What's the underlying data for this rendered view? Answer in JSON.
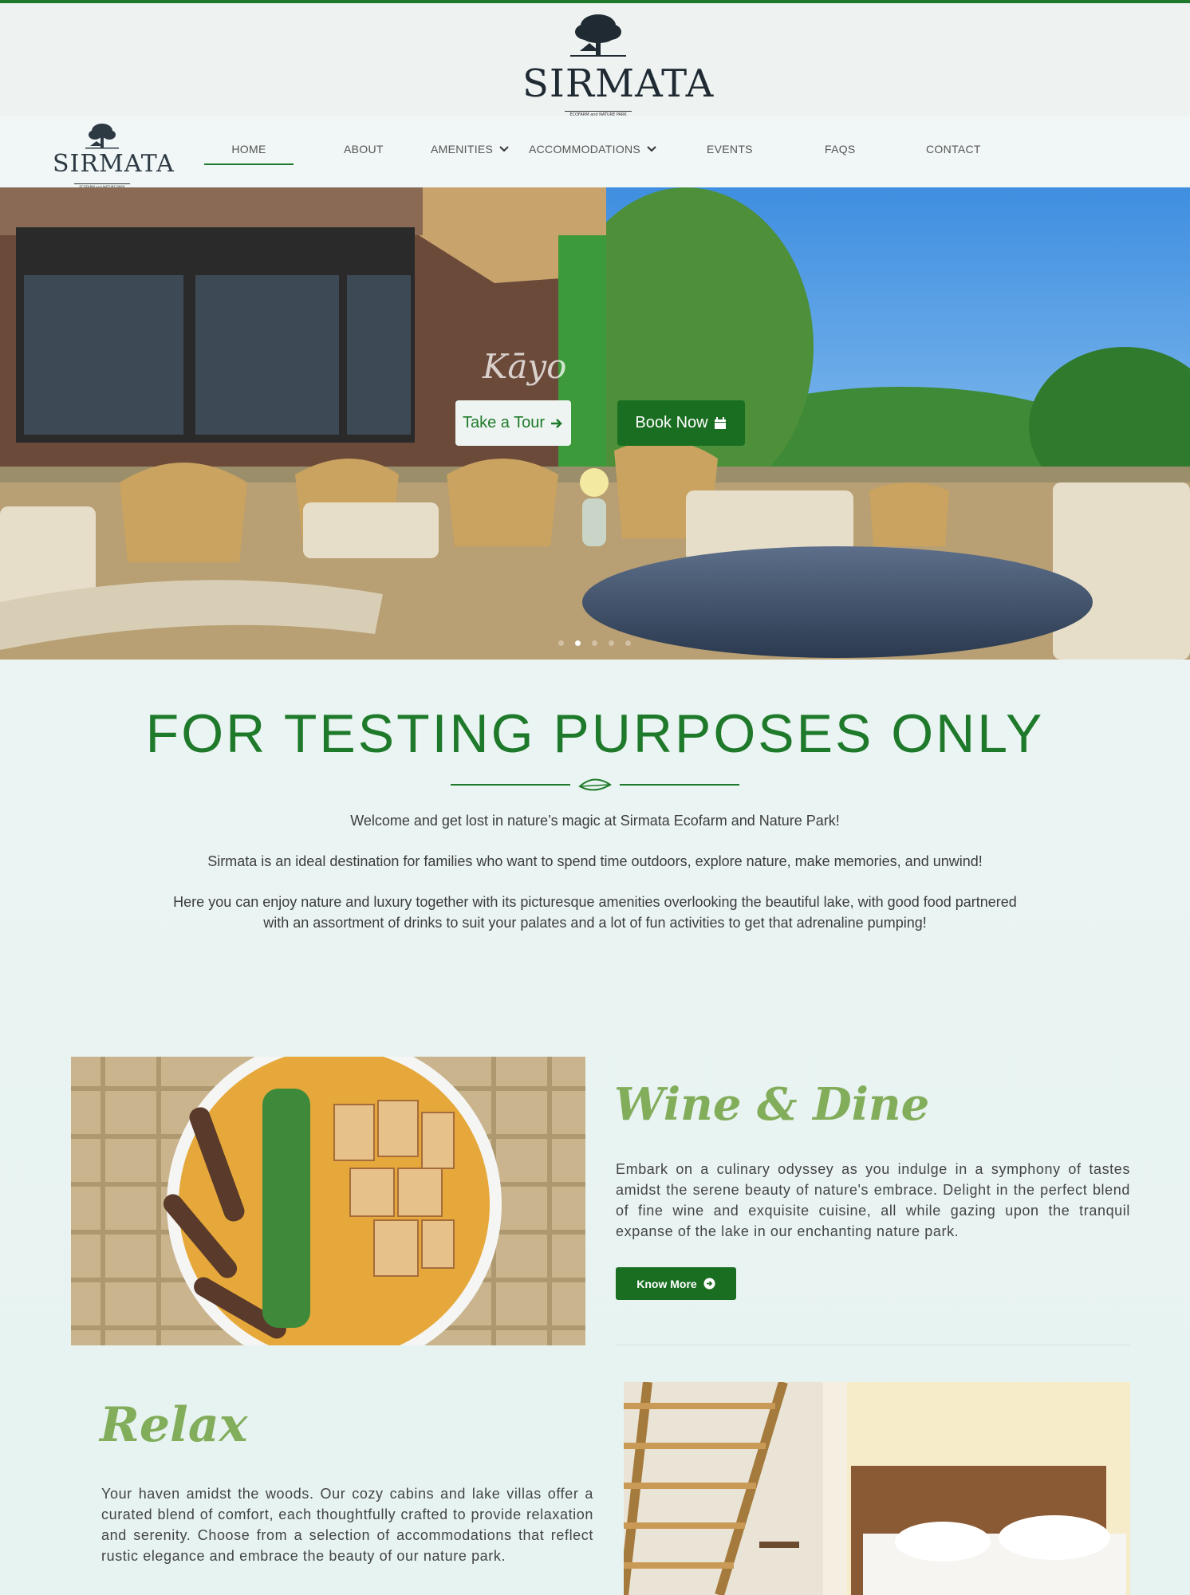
{
  "brand": {
    "name": "SIRMATA",
    "tagline": "ECOFARM and NATURE PARK"
  },
  "nav": {
    "items": [
      {
        "label": "HOME",
        "active": true
      },
      {
        "label": "ABOUT"
      },
      {
        "label": "AMENITIES",
        "has_dropdown": true
      },
      {
        "label": "ACCOMMODATIONS",
        "has_dropdown": true
      },
      {
        "label": "EVENTS"
      },
      {
        "label": "FAQS"
      },
      {
        "label": "CONTACT"
      }
    ]
  },
  "hero": {
    "script_text": "Kāyo",
    "tour_label": "Take a Tour",
    "book_label": "Book Now",
    "slide_count": 5,
    "active_slide": 2
  },
  "intro": {
    "title": "FOR TESTING PURPOSES ONLY",
    "p1": "Welcome and get lost in nature’s magic at Sirmata Ecofarm and Nature Park!",
    "p2": "Sirmata is an ideal destination for families who want to spend time outdoors, explore nature, make memories, and unwind!",
    "p3": "Here you can enjoy nature and luxury together with its picturesque amenities overlooking the beautiful lake, with good food partnered with an assortment of drinks to suit your palates and a lot of fun activities to get that adrenaline pumping!"
  },
  "wine": {
    "title": "Wine & Dine",
    "text": "Embark on a culinary odyssey as you indulge in a symphony of tastes amidst the serene beauty of nature's embrace. Delight in the perfect blend of fine wine and exquisite cuisine, all while gazing upon the tranquil expanse of the lake in our enchanting nature park.",
    "button": "Know More"
  },
  "relax": {
    "title": "Relax",
    "text": "Your haven amidst the woods. Our cozy cabins and lake villas offer a curated blend of comfort, each thoughtfully crafted to provide relaxation and serenity. Choose from a selection of accommodations that reflect rustic elegance and embrace the beauty of our nature park."
  },
  "colors": {
    "brand_green": "#1e7a2a",
    "script_green": "#82ad5a",
    "button_green": "#1a6e22"
  },
  "icons": [
    "tree-logo-icon",
    "chevron-down-icon",
    "arrow-right-icon",
    "calendar-icon",
    "leaf-icon",
    "arrow-circle-right-icon"
  ]
}
